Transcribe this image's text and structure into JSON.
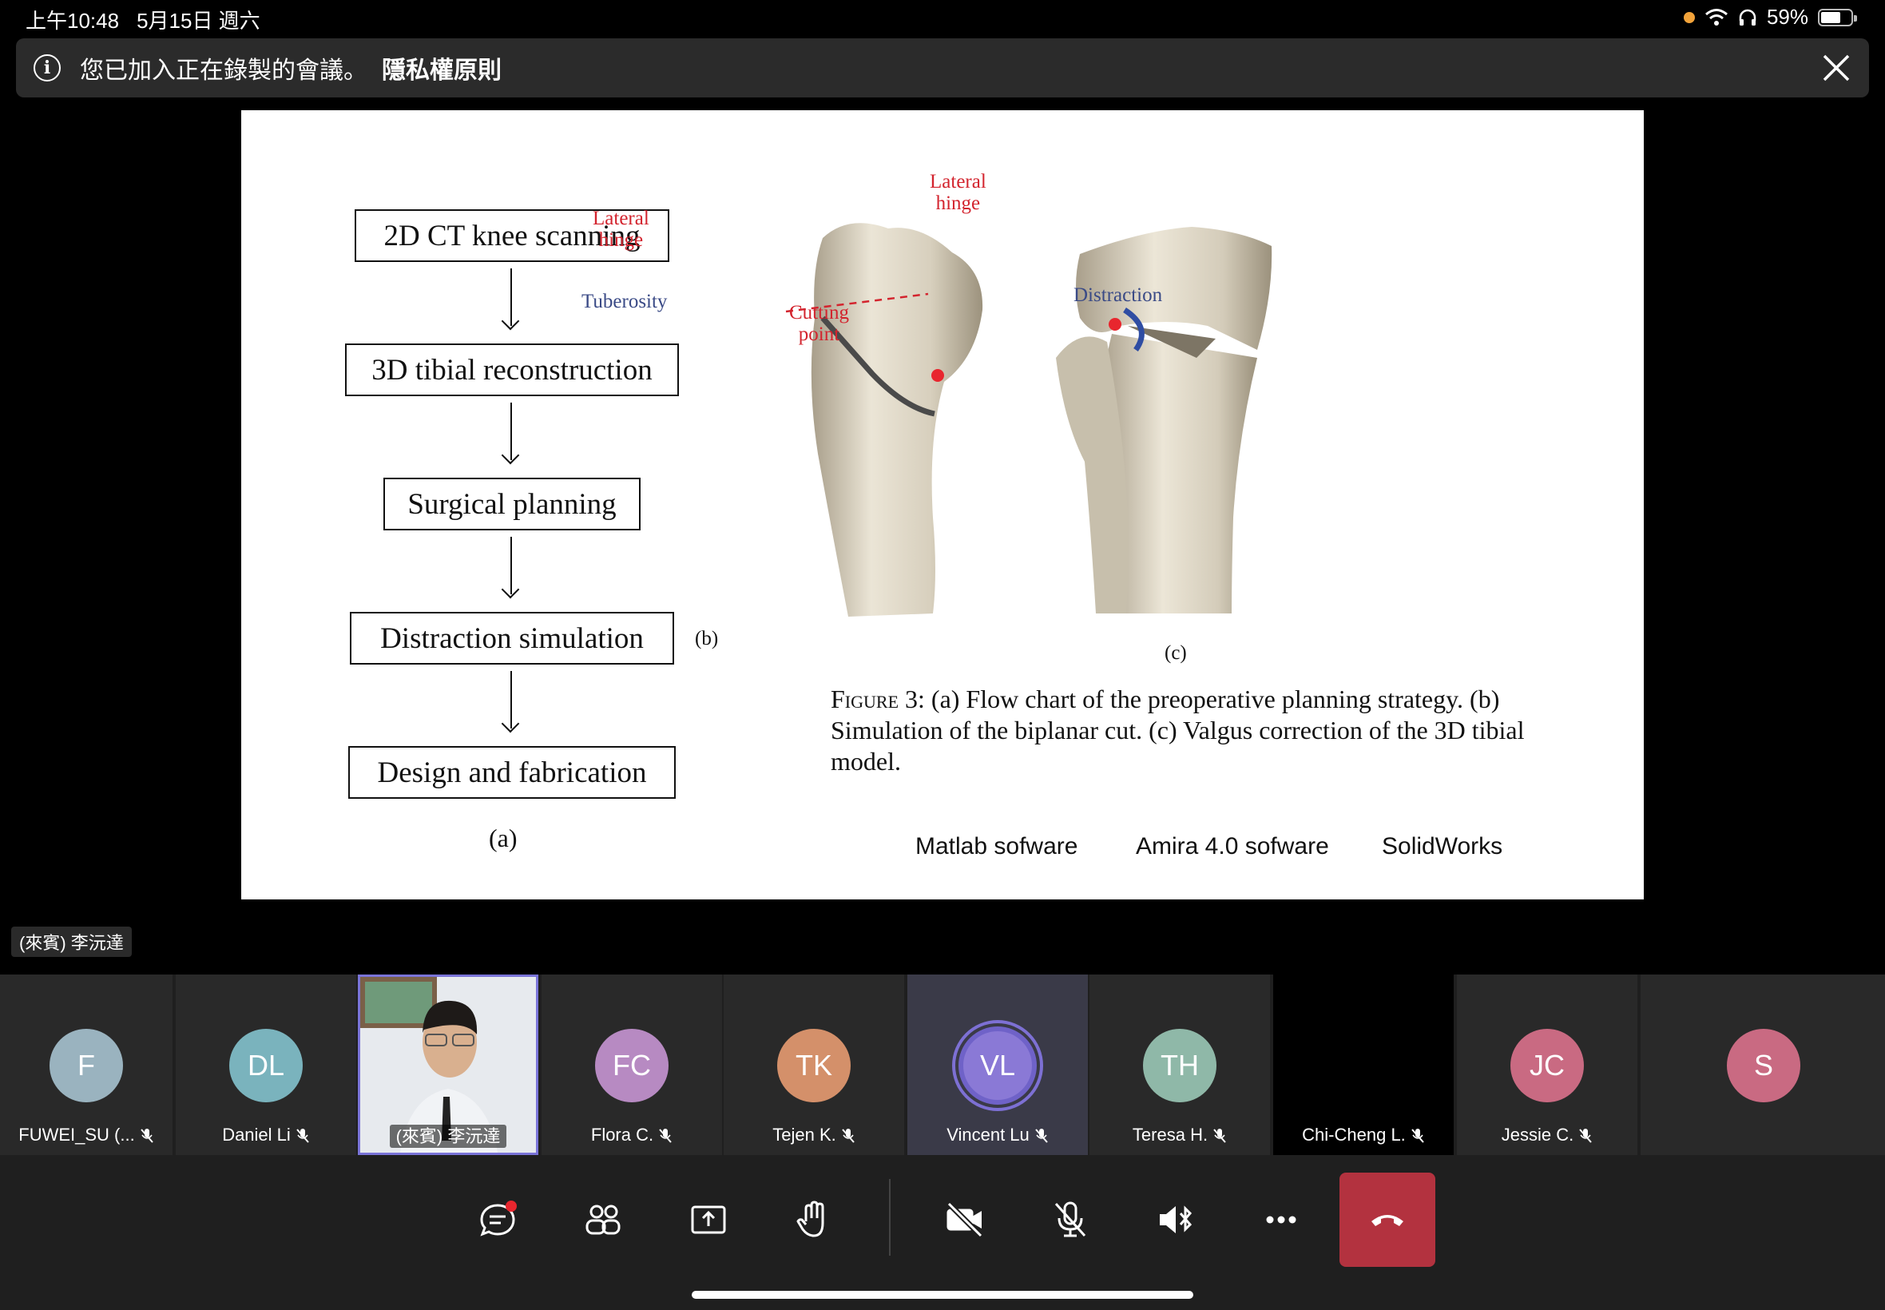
{
  "status_bar": {
    "time": "上午10:48",
    "date": "5月15日 週六",
    "battery": "59%",
    "battery_level": 0.59
  },
  "banner": {
    "message": "您已加入正在錄製的會議。",
    "link": "隱私權原則"
  },
  "slide": {
    "flowchart": [
      "2D CT knee scanning",
      "3D tibial reconstruction",
      "Surgical planning",
      "Distraction simulation",
      "Design and fabrication"
    ],
    "caption_a": "(a)",
    "caption_b": "(b)",
    "caption_c": "(c)",
    "labels_b": {
      "lateral_hinge_1": "Lateral",
      "lateral_hinge_2": "hinge",
      "tuberosity": "Tuberosity",
      "cutting_point_1": "Cutting",
      "cutting_point_2": "point"
    },
    "labels_c": {
      "lateral_hinge_1": "Lateral",
      "lateral_hinge_2": "hinge",
      "distraction": "Distraction"
    },
    "figure_caption_label": "Figure 3",
    "figure_caption_text": ": (a) Flow chart of the preoperative planning strategy. (b) Simulation of the biplanar cut. (c) Valgus correction of the 3D tibial model.",
    "software": [
      "Matlab sofware",
      "Amira 4.0 sofware",
      "SolidWorks"
    ]
  },
  "presenter_label": "(來賓) 李沅達",
  "participants": [
    {
      "initials": "F",
      "name": "FUWEI_SU (...",
      "color": "#9ab3bf"
    },
    {
      "initials": "DL",
      "name": "Daniel Li",
      "color": "#7ab3bd"
    },
    {
      "initials": "",
      "name": "(來賓) 李沅達",
      "color": ""
    },
    {
      "initials": "FC",
      "name": "Flora C.",
      "color": "#b78ac2"
    },
    {
      "initials": "TK",
      "name": "Tejen K.",
      "color": "#d4906a"
    },
    {
      "initials": "VL",
      "name": "Vincent Lu",
      "color": "#8a79d6"
    },
    {
      "initials": "TH",
      "name": "Teresa H.",
      "color": "#8fb8a8"
    },
    {
      "initials": "",
      "name": "Chi-Cheng L.",
      "color": "#000000"
    },
    {
      "initials": "JC",
      "name": "Jessie C.",
      "color": "#c96a82"
    },
    {
      "initials": "S",
      "name": "",
      "color": "#c96a82"
    }
  ],
  "toolbar": {
    "icons": [
      "chat-icon",
      "participants-icon",
      "share-icon",
      "raise-hand-icon",
      "camera-off-icon",
      "mic-off-icon",
      "speaker-icon",
      "more-icon",
      "hang-up-icon"
    ]
  }
}
